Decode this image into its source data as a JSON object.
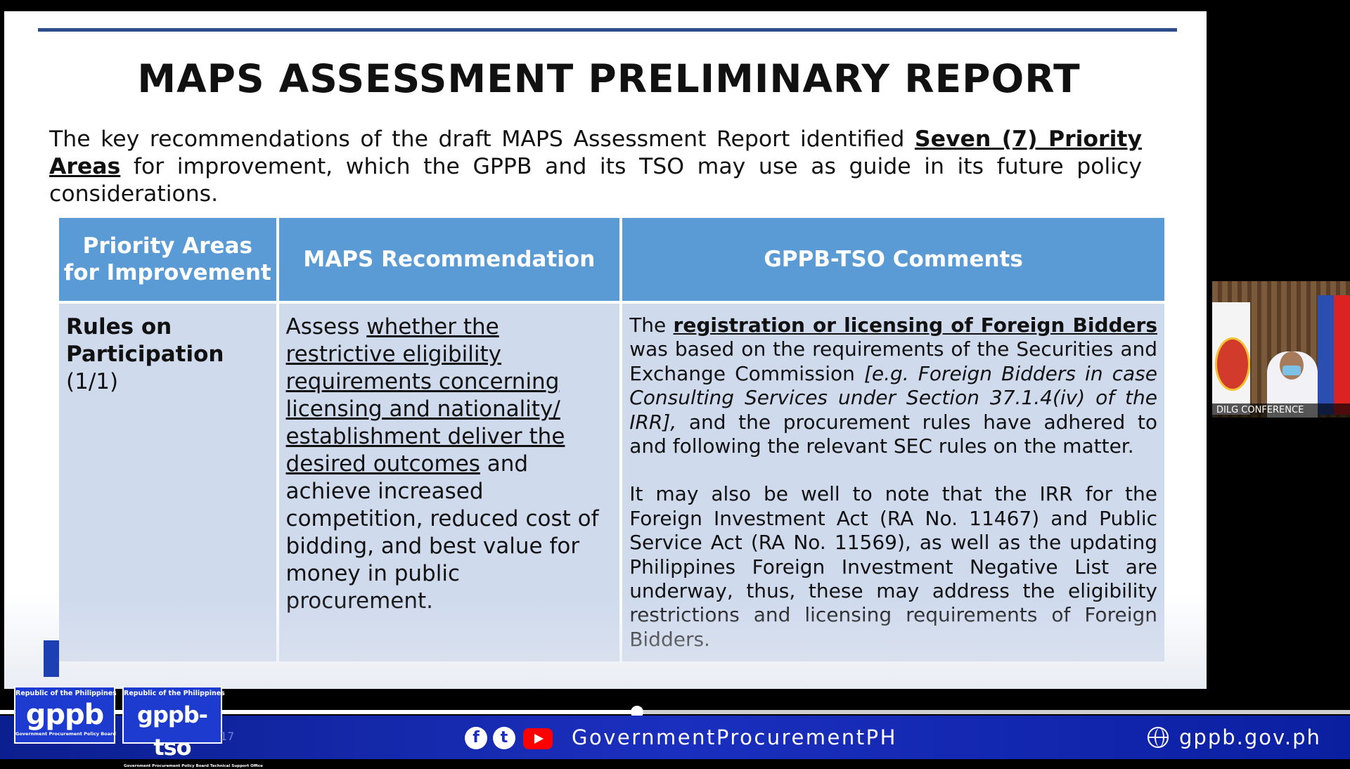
{
  "slide": {
    "title": "MAPS ASSESSMENT PRELIMINARY REPORT",
    "intro": {
      "pre": "The key recommendations of the draft MAPS Assessment Report identified ",
      "emphasis": "Seven (7) Priority Areas",
      "post": " for improvement, which the GPPB and its TSO may use as guide in its future policy considerations."
    },
    "table": {
      "headers": [
        "Priority Areas for Improvement",
        "MAPS Recommendation",
        "GPPB-TSO Comments"
      ],
      "row": {
        "area_title": "Rules on Participation",
        "area_sub": "(1/1)",
        "reco_pre": "Assess ",
        "reco_underlined": "whether the restrictive eligibility requirements concerning licensing and nationality/ establishment deliver the desired outcomes",
        "reco_post": " and achieve increased competition, reduced cost of bidding, and best value for money in public procurement.",
        "comment_p1_pre": "The ",
        "comment_p1_bold": "registration or licensing of  Foreign Bidders ",
        "comment_p1_mid": "was based on the requirements of the Securities and Exchange Commission ",
        "comment_p1_italic": "[e.g. Foreign Bidders in case Consulting Services under Section 37.1.4(iv) of the IRR],",
        "comment_p1_post": " and the procurement rules have adhered to and following the relevant SEC rules on the matter.",
        "comment_p2": "It may also be well to note that the IRR for the Foreign Investment Act (RA No. 11467) and Public Service Act (RA No. 11569), as well as the updating Philippines Foreign Investment Negative List are underway, thus, these may address the eligibility restrictions and licensing requirements of Foreign Bidders."
      }
    }
  },
  "camera": {
    "label": "DILG CONFERENCE"
  },
  "player": {
    "progress": 0.472
  },
  "footer": {
    "logo1": {
      "top": "Republic of the Philippines",
      "mark": "gppb",
      "bottom": "Government Procurement Policy Board"
    },
    "logo2": {
      "top": "Republic of the Philippines",
      "mark": "gppb-tso",
      "bottom": "Government Procurement Policy Board Technical Support Office"
    },
    "page_number": "17",
    "social_handle": "GovernmentProcurementPH",
    "website": "gppb.gov.ph",
    "icons": [
      "facebook-icon",
      "twitter-icon",
      "youtube-icon",
      "globe-icon"
    ]
  }
}
